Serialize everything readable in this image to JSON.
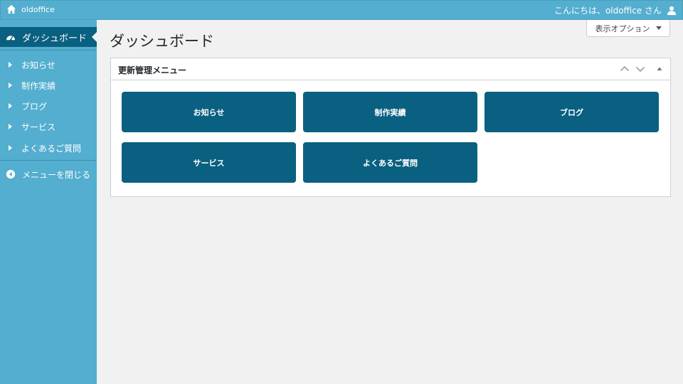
{
  "adminbar": {
    "site_name": "oldoffice",
    "greeting": "こんにちは、oldoffice さん",
    "home_icon": "home-icon",
    "user_icon": "user-icon"
  },
  "sidebar": {
    "dashboard_label": "ダッシュボード",
    "items": [
      {
        "label": "お知らせ"
      },
      {
        "label": "制作実績"
      },
      {
        "label": "ブログ"
      },
      {
        "label": "サービス"
      },
      {
        "label": "よくあるご質問"
      }
    ],
    "collapse_label": "メニューを閉じる"
  },
  "main": {
    "screen_options_label": "表示オプション",
    "page_title": "ダッシュボード",
    "panel": {
      "title": "更新管理メニュー",
      "buttons": [
        {
          "label": "お知らせ"
        },
        {
          "label": "制作実績"
        },
        {
          "label": "ブログ"
        },
        {
          "label": "サービス"
        },
        {
          "label": "よくあるご質問"
        }
      ]
    }
  },
  "colors": {
    "accent": "#53aecf",
    "dark_accent": "#0a6080",
    "background": "#f1f1f1"
  }
}
